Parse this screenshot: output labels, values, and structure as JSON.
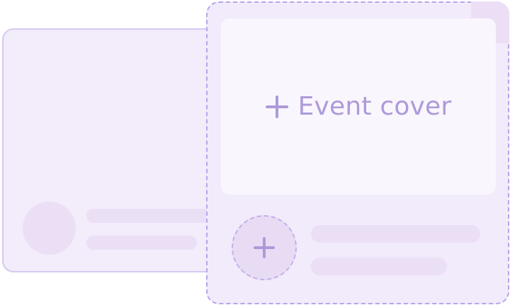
{
  "cover": {
    "label": "Event cover",
    "icon": "plus-icon"
  },
  "avatar": {
    "icon": "plus-icon"
  },
  "colors": {
    "accent": "#ad9ad9",
    "card_background": "#f1ebfb",
    "dashed_border": "#b8a5e8",
    "placeholder_fill": "#ebdff5",
    "cover_background": "#f9f6fd"
  }
}
